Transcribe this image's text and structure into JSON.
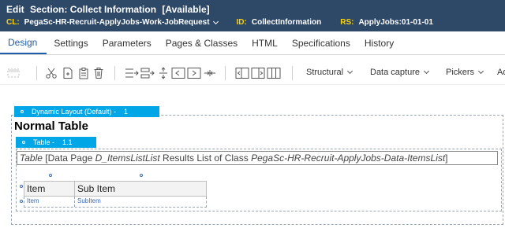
{
  "header": {
    "edit_label": "Edit",
    "title": "Section: Collect Information",
    "status": "[Available]",
    "cl_key": "CL:",
    "cl_value": "PegaSc-HR-Recruit-ApplyJobs-Work-JobRequest",
    "id_key": "ID:",
    "id_value": "CollectInformation",
    "rs_key": "RS:",
    "rs_value": "ApplyJobs:01-01-01",
    "colors": {
      "bar": "#2e4868",
      "key": "#ffd200"
    }
  },
  "tabs": [
    {
      "label": "Design",
      "active": true
    },
    {
      "label": "Settings"
    },
    {
      "label": "Parameters"
    },
    {
      "label": "Pages & Classes"
    },
    {
      "label": "HTML"
    },
    {
      "label": "Specifications"
    },
    {
      "label": "History"
    }
  ],
  "toolbar": {
    "icons": [
      "layout-select-icon",
      "cut-icon",
      "copy-icon",
      "paste-icon",
      "delete-icon",
      "insert-row-after-icon",
      "insert-row-before-icon",
      "move-row-icon",
      "insert-column-before-icon",
      "insert-column-after-icon",
      "merge-icon",
      "layout-left-icon",
      "layout-right-icon",
      "columns-icon"
    ],
    "dropdowns": {
      "structural": "Structural",
      "data_capture": "Data capture",
      "pickers": "Pickers",
      "more": "Ad"
    }
  },
  "canvas": {
    "dynamic_layout_label": "Dynamic Layout (Default) -",
    "dynamic_layout_index": "1",
    "heading": "Normal Table",
    "table_label": "Table -",
    "table_index": "1.1",
    "table_desc": {
      "prefix": "Table",
      "part1": "[Data Page",
      "data_page": "D_ItemsListList",
      "part2": "Results List of Class",
      "class_name": "PegaSc-HR-Recruit-ApplyJobs-Data-ItemsList",
      "suffix": "]"
    },
    "grid": {
      "headers": [
        "Item",
        "Sub Item"
      ],
      "row": [
        "Item",
        "SubItem"
      ]
    },
    "colors": {
      "label_bg": "#00a6e6",
      "active_tab": "#1d5fa6"
    }
  }
}
